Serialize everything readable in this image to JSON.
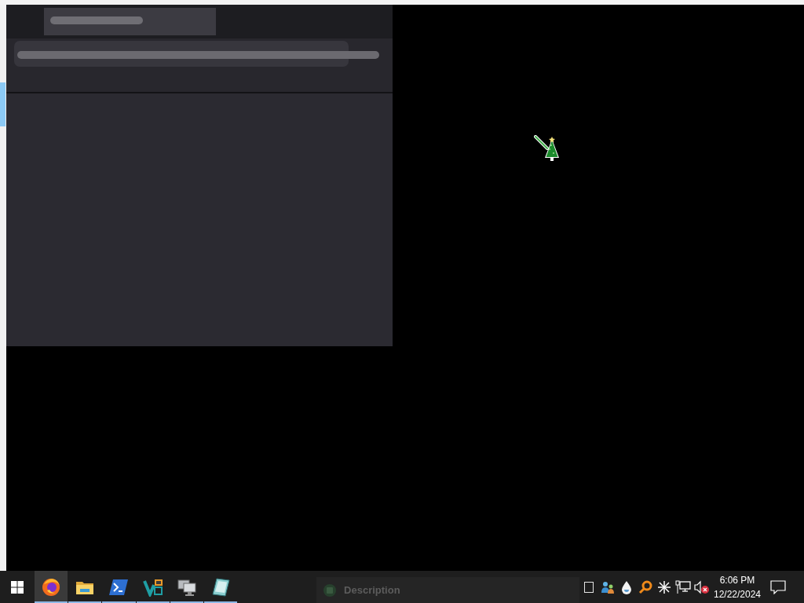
{
  "panel": {
    "loading": true
  },
  "taskbar": {
    "apps": [
      {
        "kind": "browser",
        "selected": true,
        "running": true
      },
      {
        "kind": "folder",
        "selected": false,
        "running": true
      },
      {
        "kind": "terminal",
        "selected": false,
        "running": true
      },
      {
        "kind": "v-shape",
        "selected": false,
        "running": true
      },
      {
        "kind": "monitor",
        "selected": false,
        "running": true
      },
      {
        "kind": "notebook",
        "selected": false,
        "running": true
      }
    ],
    "window_button": {
      "label": "Description"
    },
    "tray": [
      {
        "kind": "page"
      },
      {
        "kind": "users"
      },
      {
        "kind": "drop"
      },
      {
        "kind": "magnifier"
      },
      {
        "kind": "asterisk"
      },
      {
        "kind": "network"
      }
    ],
    "volume": {
      "muted": true
    },
    "clock": {
      "time": "6:06 PM",
      "date": "12/22/2024"
    }
  }
}
